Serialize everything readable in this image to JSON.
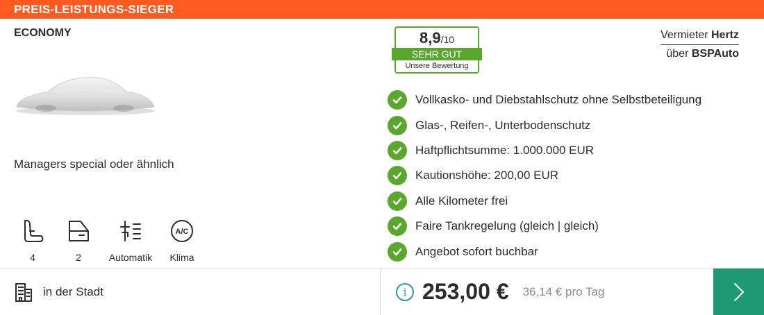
{
  "banner": {
    "label": "PREIS-LEISTUNGS-SIEGER",
    "color": "#ff5a1f"
  },
  "car": {
    "category": "ECONOMY",
    "model": "Managers special oder ähnlich",
    "image_icon": "car-silhouette-placeholder"
  },
  "features": [
    {
      "icon": "seat-icon",
      "label": "4"
    },
    {
      "icon": "door-icon",
      "label": "2"
    },
    {
      "icon": "transmission-icon",
      "label": "Automatik"
    },
    {
      "icon": "ac-icon",
      "label": "Klima",
      "icon_text": "A/C"
    }
  ],
  "rating": {
    "score": "8,9",
    "scale": "/10",
    "verdict": "SEHR GUT",
    "caption": "Unsere Bewertung",
    "color": "#5aa72d"
  },
  "vendor": {
    "prefix": "Vermieter",
    "name": "Hertz",
    "via_prefix": "über",
    "via_name": "BSPAuto"
  },
  "inclusions": [
    "Vollkasko- und Diebstahlschutz ohne Selbstbeteiligung",
    "Glas-, Reifen-, Unterbodenschutz",
    "Haftpflichtsumme: 1.000.000 EUR",
    "Kautionshöhe: 200,00 EUR",
    "Alle Kilometer frei",
    "Faire Tankregelung (gleich | gleich)",
    "Angebot sofort buchbar"
  ],
  "location": {
    "icon": "building-icon",
    "label": "in der Stadt"
  },
  "price": {
    "total": "253,00 €",
    "per_day": "36,14 € pro Tag",
    "info_icon": "info-icon"
  },
  "action": {
    "icon": "chevron-right-icon",
    "color": "#1d9a73"
  }
}
